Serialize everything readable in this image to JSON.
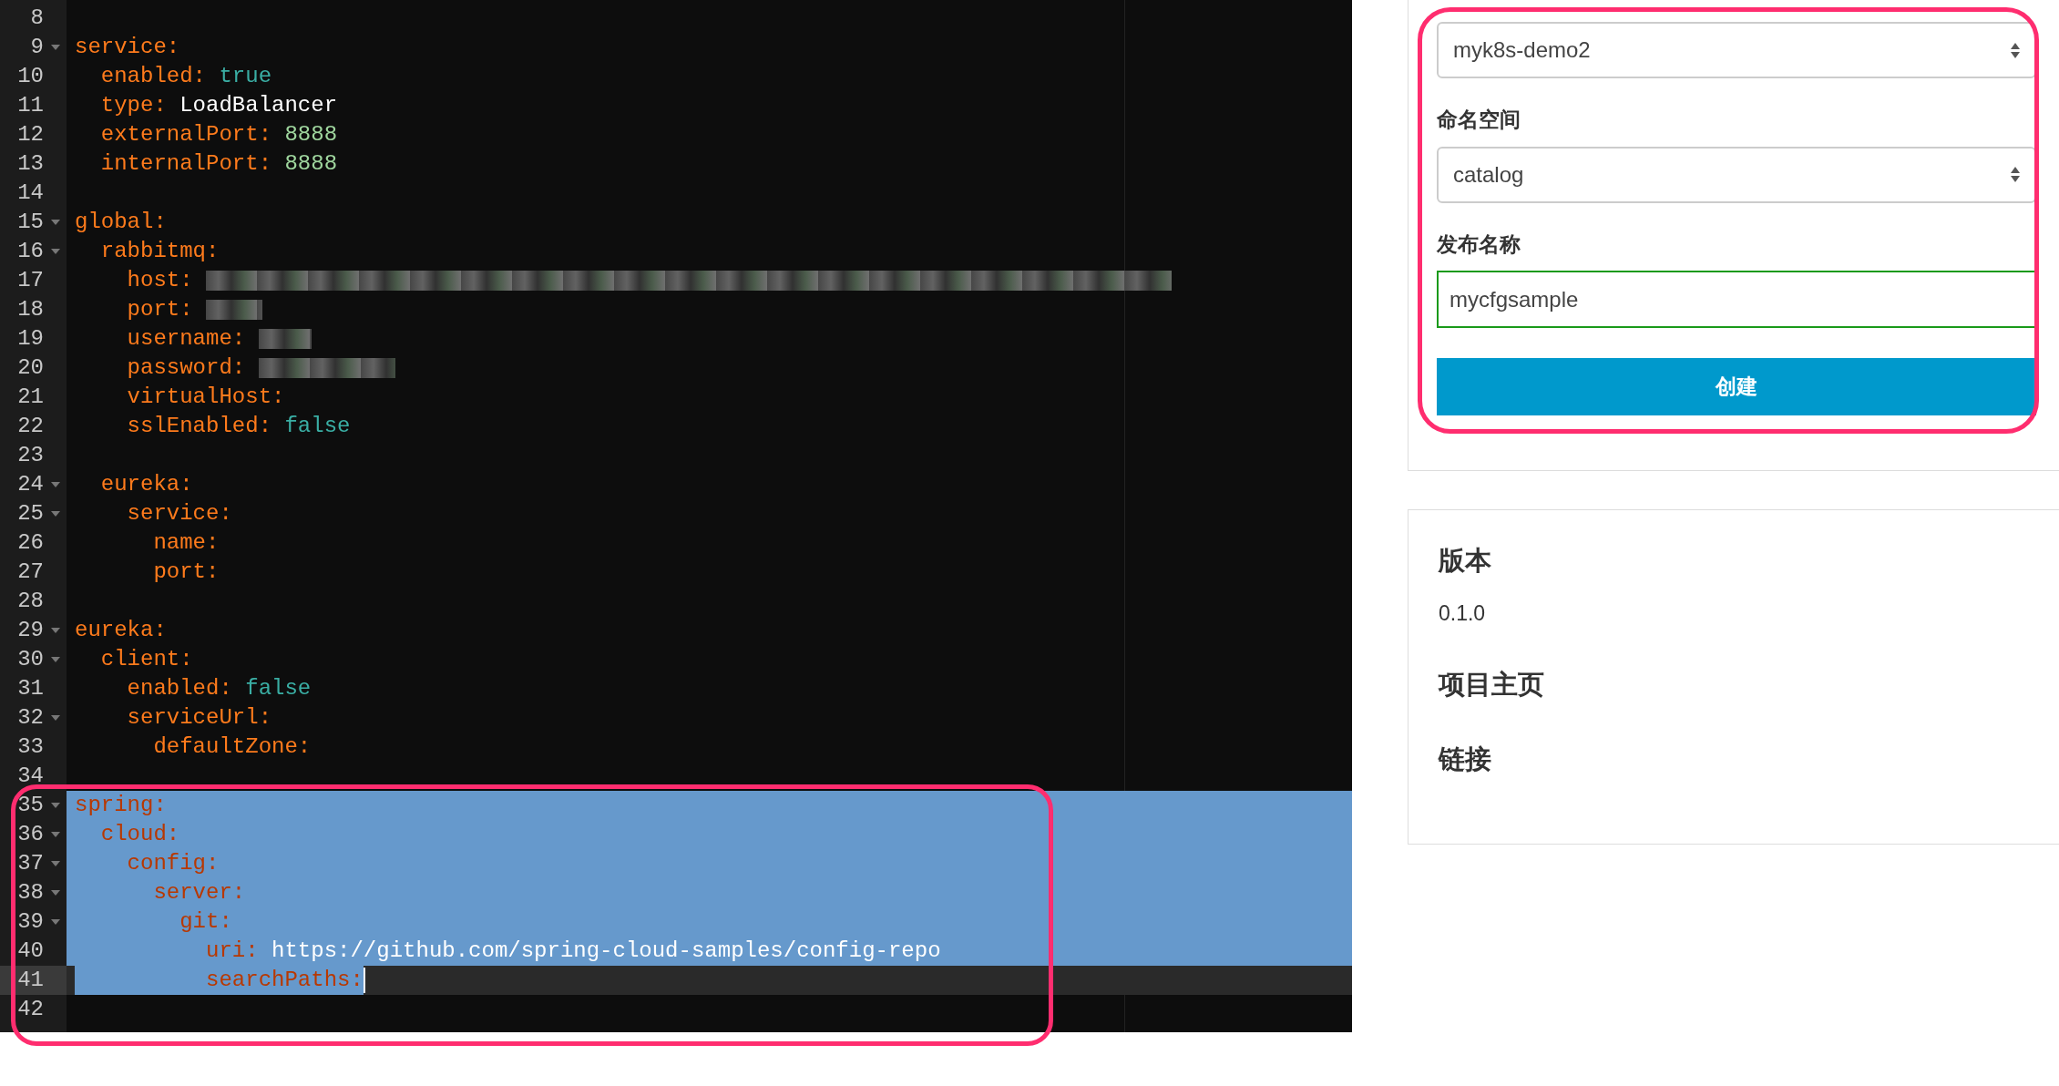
{
  "editor": {
    "highlighted": true,
    "lines": [
      {
        "number": "8",
        "fold": false
      },
      {
        "number": "9",
        "fold": true,
        "tokens": [
          {
            "text": "service:",
            "kind": "key"
          }
        ]
      },
      {
        "number": "10",
        "fold": false,
        "tokens": [
          {
            "text": "  enabled: ",
            "kind": "key"
          },
          {
            "text": "true",
            "kind": "bool"
          }
        ]
      },
      {
        "number": "11",
        "fold": false,
        "tokens": [
          {
            "text": "  type: ",
            "kind": "key"
          },
          {
            "text": "LoadBalancer",
            "kind": "plain"
          }
        ]
      },
      {
        "number": "12",
        "fold": false,
        "tokens": [
          {
            "text": "  externalPort: ",
            "kind": "key"
          },
          {
            "text": "8888",
            "kind": "num"
          }
        ]
      },
      {
        "number": "13",
        "fold": false,
        "tokens": [
          {
            "text": "  internalPort: ",
            "kind": "key"
          },
          {
            "text": "8888",
            "kind": "num"
          }
        ]
      },
      {
        "number": "14",
        "fold": false
      },
      {
        "number": "15",
        "fold": true,
        "tokens": [
          {
            "text": "global:",
            "kind": "key"
          }
        ]
      },
      {
        "number": "16",
        "fold": true,
        "tokens": [
          {
            "text": "  rabbitmq:",
            "kind": "key"
          }
        ]
      },
      {
        "number": "17",
        "fold": false,
        "redacted": true,
        "tokens": [
          {
            "text": "    host: ",
            "kind": "key"
          }
        ]
      },
      {
        "number": "18",
        "fold": false,
        "redacted": true,
        "tokens": [
          {
            "text": "    port: ",
            "kind": "key"
          }
        ]
      },
      {
        "number": "19",
        "fold": false,
        "redacted": true,
        "tokens": [
          {
            "text": "    username: ",
            "kind": "key"
          }
        ]
      },
      {
        "number": "20",
        "fold": false,
        "redacted": true,
        "tokens": [
          {
            "text": "    password: ",
            "kind": "key"
          }
        ]
      },
      {
        "number": "21",
        "fold": false,
        "tokens": [
          {
            "text": "    virtualHost:",
            "kind": "key"
          }
        ]
      },
      {
        "number": "22",
        "fold": false,
        "tokens": [
          {
            "text": "    sslEnabled: ",
            "kind": "key"
          },
          {
            "text": "false",
            "kind": "bool"
          }
        ]
      },
      {
        "number": "23",
        "fold": false
      },
      {
        "number": "24",
        "fold": true,
        "tokens": [
          {
            "text": "  eureka:",
            "kind": "key"
          }
        ]
      },
      {
        "number": "25",
        "fold": true,
        "tokens": [
          {
            "text": "    service:",
            "kind": "key"
          }
        ]
      },
      {
        "number": "26",
        "fold": false,
        "tokens": [
          {
            "text": "      name:",
            "kind": "key"
          }
        ]
      },
      {
        "number": "27",
        "fold": false,
        "tokens": [
          {
            "text": "      port:",
            "kind": "key"
          }
        ]
      },
      {
        "number": "28",
        "fold": false
      },
      {
        "number": "29",
        "fold": true,
        "tokens": [
          {
            "text": "eureka:",
            "kind": "key"
          }
        ]
      },
      {
        "number": "30",
        "fold": true,
        "tokens": [
          {
            "text": "  client:",
            "kind": "key"
          }
        ]
      },
      {
        "number": "31",
        "fold": false,
        "tokens": [
          {
            "text": "    enabled: ",
            "kind": "key"
          },
          {
            "text": "false",
            "kind": "bool"
          }
        ]
      },
      {
        "number": "32",
        "fold": true,
        "tokens": [
          {
            "text": "    serviceUrl:",
            "kind": "key"
          }
        ]
      },
      {
        "number": "33",
        "fold": false,
        "tokens": [
          {
            "text": "      defaultZone:",
            "kind": "key"
          }
        ]
      },
      {
        "number": "34",
        "fold": false
      },
      {
        "number": "35",
        "fold": true,
        "selected": true,
        "tokens": [
          {
            "text": "spring:",
            "kind": "key"
          }
        ]
      },
      {
        "number": "36",
        "fold": true,
        "selected": true,
        "tokens": [
          {
            "text": "  cloud:",
            "kind": "key"
          }
        ]
      },
      {
        "number": "37",
        "fold": true,
        "selected": true,
        "tokens": [
          {
            "text": "    config:",
            "kind": "key"
          }
        ]
      },
      {
        "number": "38",
        "fold": true,
        "selected": true,
        "tokens": [
          {
            "text": "      server:",
            "kind": "key"
          }
        ]
      },
      {
        "number": "39",
        "fold": true,
        "selected": true,
        "tokens": [
          {
            "text": "        git:",
            "kind": "key"
          }
        ]
      },
      {
        "number": "40",
        "fold": false,
        "selected": true,
        "tokens": [
          {
            "text": "          uri: ",
            "kind": "key"
          },
          {
            "text": "https://github.com/spring-cloud-samples/config-repo",
            "kind": "plain"
          }
        ]
      },
      {
        "number": "41",
        "fold": false,
        "selected": true,
        "active": true,
        "tokens": [
          {
            "text": "          searchPaths:",
            "kind": "key"
          }
        ]
      },
      {
        "number": "42",
        "fold": false
      }
    ]
  },
  "form": {
    "highlighted": true,
    "cluster_select": {
      "value": "myk8s-demo2"
    },
    "namespace": {
      "label": "命名空间",
      "value": "catalog"
    },
    "release_name": {
      "label": "发布名称",
      "value": "mycfgsample",
      "valid": true
    },
    "create_button": "创建"
  },
  "info": {
    "version_heading": "版本",
    "version": "0.1.0",
    "homepage_heading": "项目主页",
    "links_heading": "链接"
  }
}
